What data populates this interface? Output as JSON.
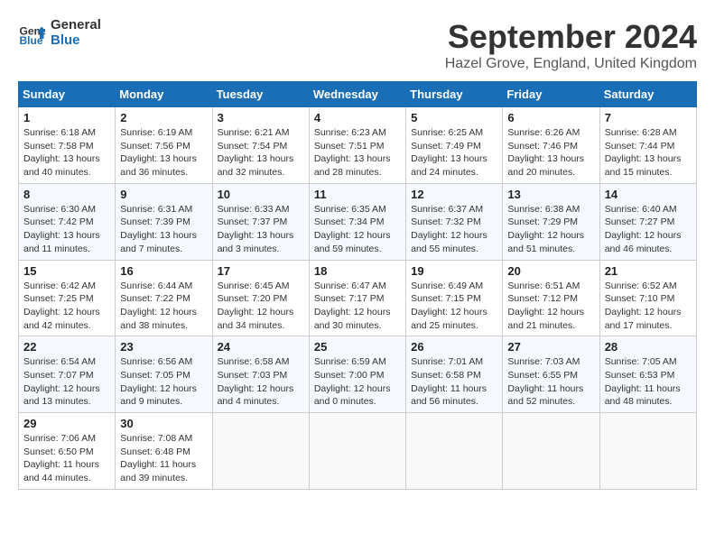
{
  "header": {
    "logo_line1": "General",
    "logo_line2": "Blue",
    "month_title": "September 2024",
    "location": "Hazel Grove, England, United Kingdom"
  },
  "calendar": {
    "headers": [
      "Sunday",
      "Monday",
      "Tuesday",
      "Wednesday",
      "Thursday",
      "Friday",
      "Saturday"
    ],
    "weeks": [
      [
        {
          "day": "1",
          "sunrise": "6:18 AM",
          "sunset": "7:58 PM",
          "daylight": "13 hours and 40 minutes."
        },
        {
          "day": "2",
          "sunrise": "6:19 AM",
          "sunset": "7:56 PM",
          "daylight": "13 hours and 36 minutes."
        },
        {
          "day": "3",
          "sunrise": "6:21 AM",
          "sunset": "7:54 PM",
          "daylight": "13 hours and 32 minutes."
        },
        {
          "day": "4",
          "sunrise": "6:23 AM",
          "sunset": "7:51 PM",
          "daylight": "13 hours and 28 minutes."
        },
        {
          "day": "5",
          "sunrise": "6:25 AM",
          "sunset": "7:49 PM",
          "daylight": "13 hours and 24 minutes."
        },
        {
          "day": "6",
          "sunrise": "6:26 AM",
          "sunset": "7:46 PM",
          "daylight": "13 hours and 20 minutes."
        },
        {
          "day": "7",
          "sunrise": "6:28 AM",
          "sunset": "7:44 PM",
          "daylight": "13 hours and 15 minutes."
        }
      ],
      [
        {
          "day": "8",
          "sunrise": "6:30 AM",
          "sunset": "7:42 PM",
          "daylight": "13 hours and 11 minutes."
        },
        {
          "day": "9",
          "sunrise": "6:31 AM",
          "sunset": "7:39 PM",
          "daylight": "13 hours and 7 minutes."
        },
        {
          "day": "10",
          "sunrise": "6:33 AM",
          "sunset": "7:37 PM",
          "daylight": "13 hours and 3 minutes."
        },
        {
          "day": "11",
          "sunrise": "6:35 AM",
          "sunset": "7:34 PM",
          "daylight": "12 hours and 59 minutes."
        },
        {
          "day": "12",
          "sunrise": "6:37 AM",
          "sunset": "7:32 PM",
          "daylight": "12 hours and 55 minutes."
        },
        {
          "day": "13",
          "sunrise": "6:38 AM",
          "sunset": "7:29 PM",
          "daylight": "12 hours and 51 minutes."
        },
        {
          "day": "14",
          "sunrise": "6:40 AM",
          "sunset": "7:27 PM",
          "daylight": "12 hours and 46 minutes."
        }
      ],
      [
        {
          "day": "15",
          "sunrise": "6:42 AM",
          "sunset": "7:25 PM",
          "daylight": "12 hours and 42 minutes."
        },
        {
          "day": "16",
          "sunrise": "6:44 AM",
          "sunset": "7:22 PM",
          "daylight": "12 hours and 38 minutes."
        },
        {
          "day": "17",
          "sunrise": "6:45 AM",
          "sunset": "7:20 PM",
          "daylight": "12 hours and 34 minutes."
        },
        {
          "day": "18",
          "sunrise": "6:47 AM",
          "sunset": "7:17 PM",
          "daylight": "12 hours and 30 minutes."
        },
        {
          "day": "19",
          "sunrise": "6:49 AM",
          "sunset": "7:15 PM",
          "daylight": "12 hours and 25 minutes."
        },
        {
          "day": "20",
          "sunrise": "6:51 AM",
          "sunset": "7:12 PM",
          "daylight": "12 hours and 21 minutes."
        },
        {
          "day": "21",
          "sunrise": "6:52 AM",
          "sunset": "7:10 PM",
          "daylight": "12 hours and 17 minutes."
        }
      ],
      [
        {
          "day": "22",
          "sunrise": "6:54 AM",
          "sunset": "7:07 PM",
          "daylight": "12 hours and 13 minutes."
        },
        {
          "day": "23",
          "sunrise": "6:56 AM",
          "sunset": "7:05 PM",
          "daylight": "12 hours and 9 minutes."
        },
        {
          "day": "24",
          "sunrise": "6:58 AM",
          "sunset": "7:03 PM",
          "daylight": "12 hours and 4 minutes."
        },
        {
          "day": "25",
          "sunrise": "6:59 AM",
          "sunset": "7:00 PM",
          "daylight": "12 hours and 0 minutes."
        },
        {
          "day": "26",
          "sunrise": "7:01 AM",
          "sunset": "6:58 PM",
          "daylight": "11 hours and 56 minutes."
        },
        {
          "day": "27",
          "sunrise": "7:03 AM",
          "sunset": "6:55 PM",
          "daylight": "11 hours and 52 minutes."
        },
        {
          "day": "28",
          "sunrise": "7:05 AM",
          "sunset": "6:53 PM",
          "daylight": "11 hours and 48 minutes."
        }
      ],
      [
        {
          "day": "29",
          "sunrise": "7:06 AM",
          "sunset": "6:50 PM",
          "daylight": "11 hours and 44 minutes."
        },
        {
          "day": "30",
          "sunrise": "7:08 AM",
          "sunset": "6:48 PM",
          "daylight": "11 hours and 39 minutes."
        },
        {
          "day": "",
          "sunrise": "",
          "sunset": "",
          "daylight": ""
        },
        {
          "day": "",
          "sunrise": "",
          "sunset": "",
          "daylight": ""
        },
        {
          "day": "",
          "sunrise": "",
          "sunset": "",
          "daylight": ""
        },
        {
          "day": "",
          "sunrise": "",
          "sunset": "",
          "daylight": ""
        },
        {
          "day": "",
          "sunrise": "",
          "sunset": "",
          "daylight": ""
        }
      ]
    ]
  }
}
